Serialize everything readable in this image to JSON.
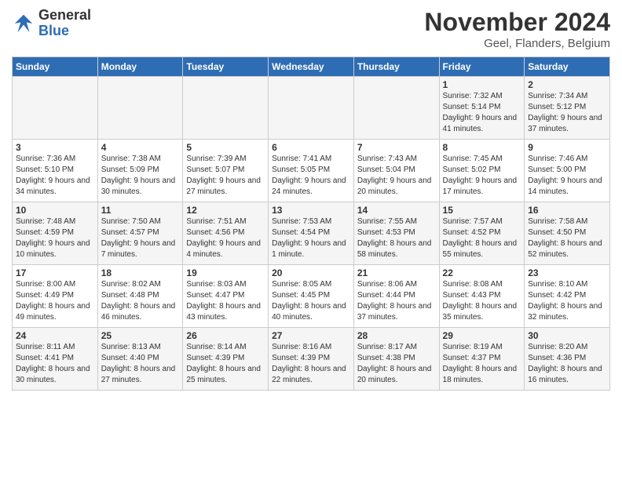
{
  "header": {
    "logo_line1": "General",
    "logo_line2": "Blue",
    "title": "November 2024",
    "subtitle": "Geel, Flanders, Belgium"
  },
  "days_of_week": [
    "Sunday",
    "Monday",
    "Tuesday",
    "Wednesday",
    "Thursday",
    "Friday",
    "Saturday"
  ],
  "weeks": [
    [
      {
        "day": "",
        "info": ""
      },
      {
        "day": "",
        "info": ""
      },
      {
        "day": "",
        "info": ""
      },
      {
        "day": "",
        "info": ""
      },
      {
        "day": "",
        "info": ""
      },
      {
        "day": "1",
        "info": "Sunrise: 7:32 AM\nSunset: 5:14 PM\nDaylight: 9 hours and 41 minutes."
      },
      {
        "day": "2",
        "info": "Sunrise: 7:34 AM\nSunset: 5:12 PM\nDaylight: 9 hours and 37 minutes."
      }
    ],
    [
      {
        "day": "3",
        "info": "Sunrise: 7:36 AM\nSunset: 5:10 PM\nDaylight: 9 hours and 34 minutes."
      },
      {
        "day": "4",
        "info": "Sunrise: 7:38 AM\nSunset: 5:09 PM\nDaylight: 9 hours and 30 minutes."
      },
      {
        "day": "5",
        "info": "Sunrise: 7:39 AM\nSunset: 5:07 PM\nDaylight: 9 hours and 27 minutes."
      },
      {
        "day": "6",
        "info": "Sunrise: 7:41 AM\nSunset: 5:05 PM\nDaylight: 9 hours and 24 minutes."
      },
      {
        "day": "7",
        "info": "Sunrise: 7:43 AM\nSunset: 5:04 PM\nDaylight: 9 hours and 20 minutes."
      },
      {
        "day": "8",
        "info": "Sunrise: 7:45 AM\nSunset: 5:02 PM\nDaylight: 9 hours and 17 minutes."
      },
      {
        "day": "9",
        "info": "Sunrise: 7:46 AM\nSunset: 5:00 PM\nDaylight: 9 hours and 14 minutes."
      }
    ],
    [
      {
        "day": "10",
        "info": "Sunrise: 7:48 AM\nSunset: 4:59 PM\nDaylight: 9 hours and 10 minutes."
      },
      {
        "day": "11",
        "info": "Sunrise: 7:50 AM\nSunset: 4:57 PM\nDaylight: 9 hours and 7 minutes."
      },
      {
        "day": "12",
        "info": "Sunrise: 7:51 AM\nSunset: 4:56 PM\nDaylight: 9 hours and 4 minutes."
      },
      {
        "day": "13",
        "info": "Sunrise: 7:53 AM\nSunset: 4:54 PM\nDaylight: 9 hours and 1 minute."
      },
      {
        "day": "14",
        "info": "Sunrise: 7:55 AM\nSunset: 4:53 PM\nDaylight: 8 hours and 58 minutes."
      },
      {
        "day": "15",
        "info": "Sunrise: 7:57 AM\nSunset: 4:52 PM\nDaylight: 8 hours and 55 minutes."
      },
      {
        "day": "16",
        "info": "Sunrise: 7:58 AM\nSunset: 4:50 PM\nDaylight: 8 hours and 52 minutes."
      }
    ],
    [
      {
        "day": "17",
        "info": "Sunrise: 8:00 AM\nSunset: 4:49 PM\nDaylight: 8 hours and 49 minutes."
      },
      {
        "day": "18",
        "info": "Sunrise: 8:02 AM\nSunset: 4:48 PM\nDaylight: 8 hours and 46 minutes."
      },
      {
        "day": "19",
        "info": "Sunrise: 8:03 AM\nSunset: 4:47 PM\nDaylight: 8 hours and 43 minutes."
      },
      {
        "day": "20",
        "info": "Sunrise: 8:05 AM\nSunset: 4:45 PM\nDaylight: 8 hours and 40 minutes."
      },
      {
        "day": "21",
        "info": "Sunrise: 8:06 AM\nSunset: 4:44 PM\nDaylight: 8 hours and 37 minutes."
      },
      {
        "day": "22",
        "info": "Sunrise: 8:08 AM\nSunset: 4:43 PM\nDaylight: 8 hours and 35 minutes."
      },
      {
        "day": "23",
        "info": "Sunrise: 8:10 AM\nSunset: 4:42 PM\nDaylight: 8 hours and 32 minutes."
      }
    ],
    [
      {
        "day": "24",
        "info": "Sunrise: 8:11 AM\nSunset: 4:41 PM\nDaylight: 8 hours and 30 minutes."
      },
      {
        "day": "25",
        "info": "Sunrise: 8:13 AM\nSunset: 4:40 PM\nDaylight: 8 hours and 27 minutes."
      },
      {
        "day": "26",
        "info": "Sunrise: 8:14 AM\nSunset: 4:39 PM\nDaylight: 8 hours and 25 minutes."
      },
      {
        "day": "27",
        "info": "Sunrise: 8:16 AM\nSunset: 4:39 PM\nDaylight: 8 hours and 22 minutes."
      },
      {
        "day": "28",
        "info": "Sunrise: 8:17 AM\nSunset: 4:38 PM\nDaylight: 8 hours and 20 minutes."
      },
      {
        "day": "29",
        "info": "Sunrise: 8:19 AM\nSunset: 4:37 PM\nDaylight: 8 hours and 18 minutes."
      },
      {
        "day": "30",
        "info": "Sunrise: 8:20 AM\nSunset: 4:36 PM\nDaylight: 8 hours and 16 minutes."
      }
    ]
  ]
}
